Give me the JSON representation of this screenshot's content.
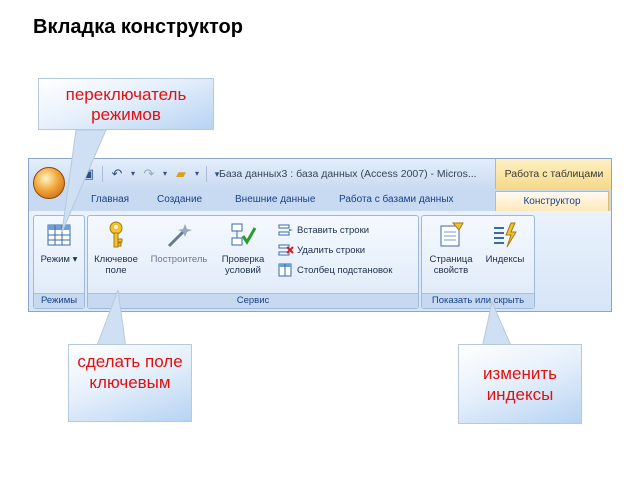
{
  "slide": {
    "title": "Вкладка конструктор"
  },
  "callouts": {
    "modes": "переключатель режимов",
    "key": "сделать поле ключевым",
    "indexes": "изменить индексы"
  },
  "window": {
    "title": "База данных3 : база данных (Access 2007) - Micros...",
    "context_tab_group": "Работа с таблицами"
  },
  "tabs": [
    "Главная",
    "Создание",
    "Внешние данные",
    "Работа с базами данных",
    "Конструктор"
  ],
  "active_tab": "Конструктор",
  "groups": {
    "modes": {
      "label": "Режимы",
      "buttons": [
        {
          "icon": "table-grid-icon",
          "label": "Режим ▾"
        }
      ]
    },
    "service": {
      "label": "Сервис",
      "buttons": [
        {
          "icon": "key-icon",
          "label": "Ключевое поле"
        },
        {
          "icon": "wand-icon",
          "label": "Построитель"
        },
        {
          "icon": "check-rules-icon",
          "label": "Проверка условий"
        }
      ],
      "small_buttons": [
        {
          "icon": "insert-rows-icon",
          "label": "Вставить строки"
        },
        {
          "icon": "delete-rows-icon",
          "label": "Удалить строки"
        },
        {
          "icon": "lookup-column-icon",
          "label": "Столбец подстановок"
        }
      ]
    },
    "show_hide": {
      "label": "Показать или скрыть",
      "buttons": [
        {
          "icon": "property-sheet-icon",
          "label": "Страница свойств"
        },
        {
          "icon": "indexes-icon",
          "label": "Индексы"
        }
      ]
    }
  },
  "colors": {
    "callout_text": "#e01010",
    "ribbon_text": "#15428b"
  }
}
